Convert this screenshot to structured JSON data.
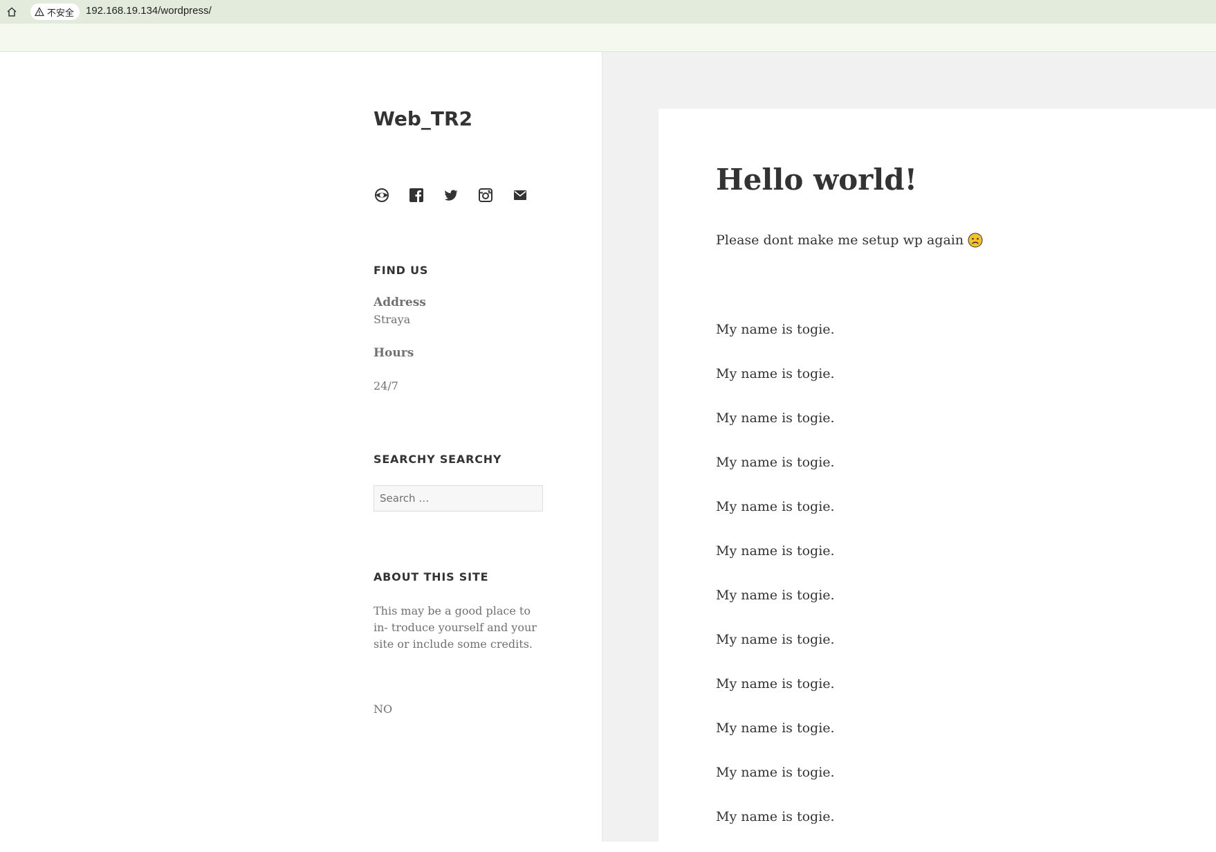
{
  "browser": {
    "security_label": "不安全",
    "url": "192.168.19.134/wordpress/"
  },
  "sidebar": {
    "site_title": "Web_TR2",
    "social_icons": [
      "wordpress-icon",
      "facebook-icon",
      "twitter-icon",
      "instagram-icon",
      "email-icon"
    ],
    "find_us": {
      "title": "FIND US",
      "address_label": "Address",
      "address_value": "Straya",
      "hours_label": "Hours",
      "hours_value": "24/7"
    },
    "search": {
      "title": "SEARCHY SEARCHY",
      "placeholder": "Search …"
    },
    "about": {
      "title": "ABOUT THIS SITE",
      "text": "This may be a good place to in- troduce yourself and your site or include some credits."
    },
    "footer_text": "NO"
  },
  "post": {
    "title": "Hello world!",
    "intro": "Please dont make me setup wp again",
    "lines": [
      "My name is togie.",
      "My name is togie.",
      "My name is togie.",
      "My name is togie.",
      "My name is togie.",
      "My name is togie.",
      "My name is togie.",
      "My name is togie.",
      "My name is togie.",
      "My name is togie.",
      "My name is togie.",
      "My name is togie."
    ]
  },
  "colors": {
    "browser_bar": "#e3ecdc",
    "content_bg": "#f1f1f1",
    "text": "#333333",
    "muted": "#707070"
  }
}
